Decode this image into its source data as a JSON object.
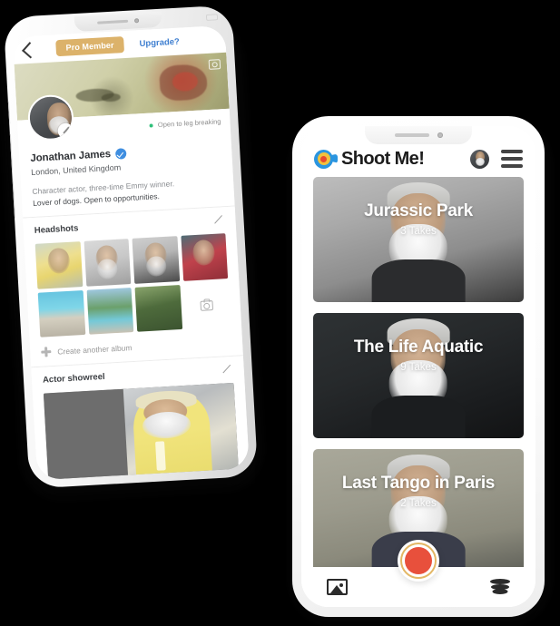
{
  "left_phone": {
    "topbar": {
      "back_icon": "back-chevron-icon",
      "pro_badge": "Pro Member",
      "upgrade_link": "Upgrade?"
    },
    "cover": {
      "camera_icon": "camera-icon"
    },
    "profile": {
      "avatar_edit_icon": "pencil-icon",
      "status_text": "Open to leg breaking",
      "name": "Jonathan James",
      "verified_icon": "verified-check-icon",
      "location": "London, United Kingdom",
      "bio_line1": "Character actor, three-time Emmy winner.",
      "bio_line2_a": "Lover of dogs.",
      "bio_line2_b": "Open to opportunities."
    },
    "headshots": {
      "title": "Headshots",
      "edit_icon": "pencil-icon",
      "photos": [
        {
          "alt": "headshot-yellow-shirt"
        },
        {
          "alt": "headshot-grey-backdrop"
        },
        {
          "alt": "headshot-dark-backdrop"
        },
        {
          "alt": "headshot-red-shirt"
        },
        {
          "alt": "photo-beach-pool"
        },
        {
          "alt": "photo-seaside"
        },
        {
          "alt": "photo-hedge"
        }
      ],
      "add_photo_icon": "camera-icon",
      "create_album_label": "Create another album",
      "create_album_icon": "plus-icon"
    },
    "showreel": {
      "title": "Actor showreel",
      "edit_icon": "pencil-icon",
      "thumb_alt": "showreel-video-thumbnail"
    }
  },
  "right_phone": {
    "header": {
      "logo_icon": "target-camera-logo-icon",
      "logo_text": "Shoot Me!",
      "avatar_icon": "user-avatar",
      "menu_icon": "hamburger-menu-icon"
    },
    "projects": [
      {
        "title": "Jurassic Park",
        "takes": "3 Takes",
        "theme": "card-a"
      },
      {
        "title": "The Life Aquatic",
        "takes": "9 Takes",
        "theme": "card-b"
      },
      {
        "title": "Last Tango in Paris",
        "takes": "2 Takes",
        "theme": "card-c"
      }
    ],
    "bottom_nav": {
      "gallery_icon": "gallery-icon",
      "record_icon": "record-button-icon",
      "layers_icon": "layers-icon"
    }
  },
  "colors": {
    "background": "#000000",
    "pro_badge": "#dcb26a",
    "upgrade_link": "#3f7fd0",
    "verified_blue": "#3f8ee0",
    "status_green": "#2fc07a",
    "logo_blue": "#2a95e0",
    "logo_yellow": "#f2c13c",
    "logo_red": "#e8492f",
    "record_ring": "#e3b765",
    "record_core": "#e8503c"
  }
}
